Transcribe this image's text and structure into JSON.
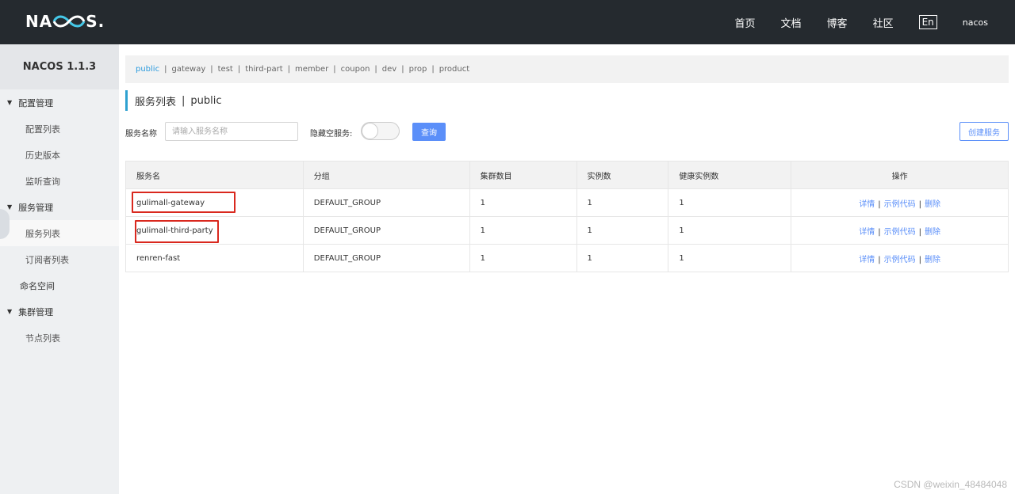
{
  "header": {
    "logo_text_left": "NA",
    "logo_text_right": "S.",
    "nav": [
      "首页",
      "文档",
      "博客",
      "社区"
    ],
    "lang": "En",
    "user": "nacos"
  },
  "sidebar": {
    "title": "NACOS 1.1.3",
    "groups": [
      {
        "label": "配置管理",
        "items": [
          "配置列表",
          "历史版本",
          "监听查询"
        ]
      },
      {
        "label": "服务管理",
        "items": [
          "服务列表",
          "订阅者列表"
        ]
      }
    ],
    "namespace": "命名空间",
    "cluster": {
      "label": "集群管理",
      "items": [
        "节点列表"
      ]
    }
  },
  "namespaces": [
    "public",
    "gateway",
    "test",
    "third-part",
    "member",
    "coupon",
    "dev",
    "prop",
    "product"
  ],
  "page": {
    "title": "服务列表",
    "namespace": "public"
  },
  "filter": {
    "name_label": "服务名称",
    "name_placeholder": "请输入服务名称",
    "hide_empty_label": "隐藏空服务:",
    "query_label": "查询",
    "create_label": "创建服务"
  },
  "table": {
    "headers": [
      "服务名",
      "分组",
      "集群数目",
      "实例数",
      "健康实例数",
      "操作"
    ],
    "rows": [
      {
        "name": "gulimall-gateway",
        "group": "DEFAULT_GROUP",
        "clusters": "1",
        "instances": "1",
        "healthy": "1"
      },
      {
        "name": "gulimall-third-party",
        "group": "DEFAULT_GROUP",
        "clusters": "1",
        "instances": "1",
        "healthy": "1"
      },
      {
        "name": "renren-fast",
        "group": "DEFAULT_GROUP",
        "clusters": "1",
        "instances": "1",
        "healthy": "1"
      }
    ],
    "ops": {
      "detail": "详情",
      "sample": "示例代码",
      "delete": "删除",
      "separator": "|"
    }
  },
  "colors": {
    "accent": "#5b8ff9",
    "header_bg": "#252a2f",
    "highlight": "#d9281e"
  },
  "watermark": "CSDN @weixin_48484048"
}
